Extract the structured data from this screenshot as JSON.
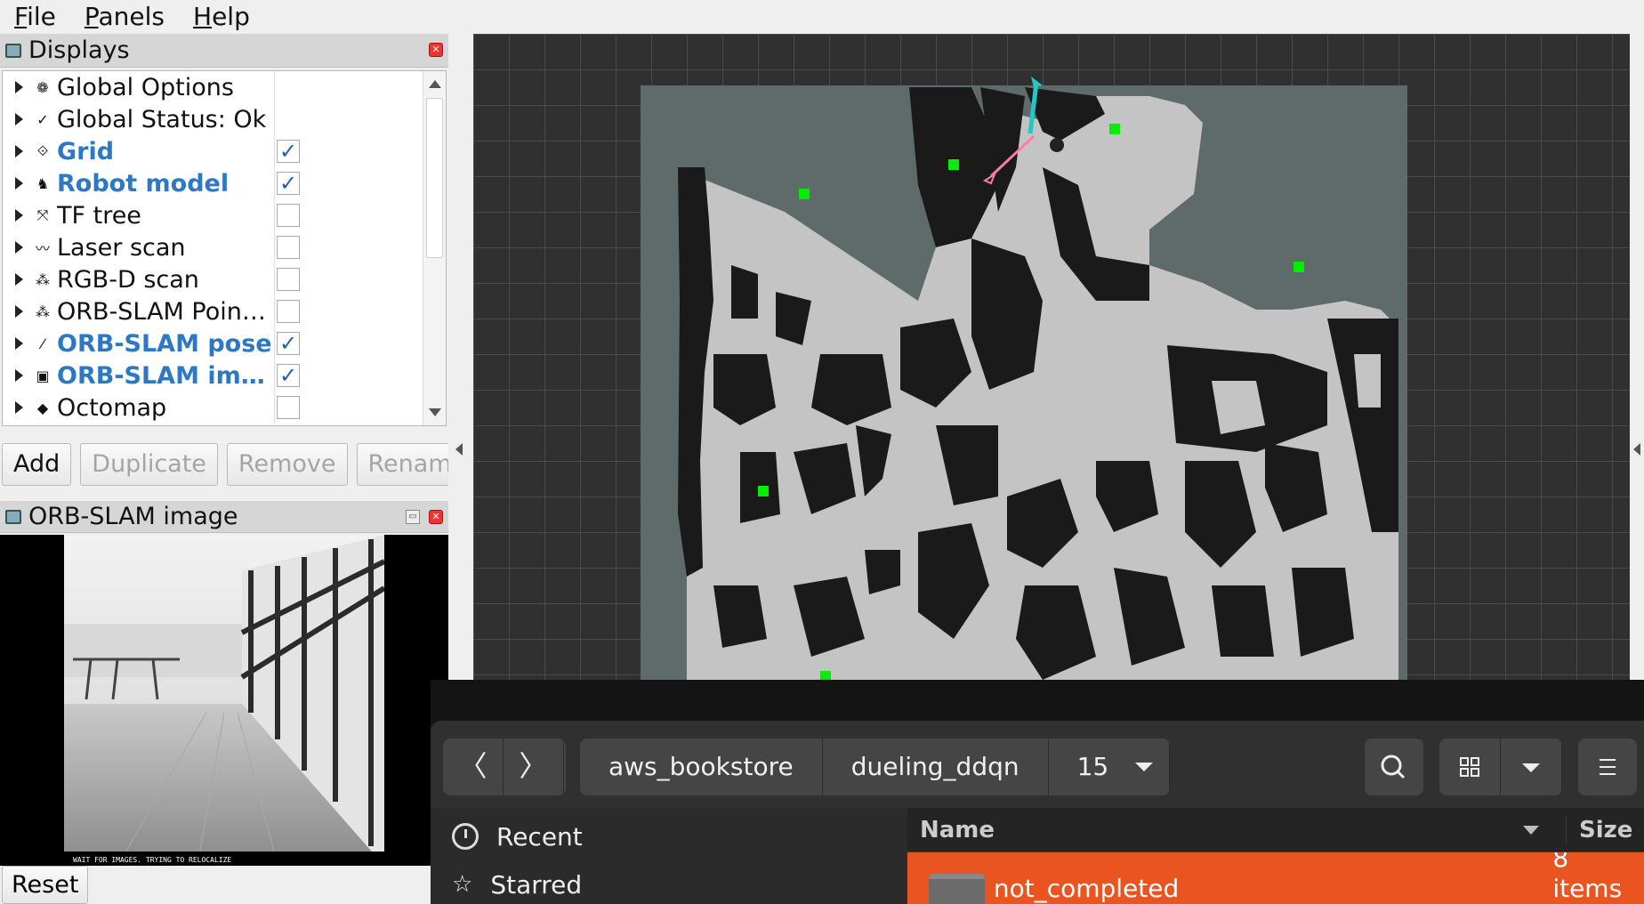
{
  "menubar": {
    "items": [
      {
        "label": "File",
        "accel": "F",
        "rest": "ile"
      },
      {
        "label": "Panels",
        "accel": "P",
        "rest": "anels"
      },
      {
        "label": "Help",
        "accel": "H",
        "rest": "elp"
      }
    ]
  },
  "displays": {
    "title": "Displays",
    "items": [
      {
        "label": "Global Options",
        "icon": "gear-icon",
        "glyph": "❁",
        "checked": null,
        "enabled": false
      },
      {
        "label": "Global Status: Ok",
        "icon": "checkmark-icon",
        "glyph": "✓",
        "checked": null,
        "enabled": false
      },
      {
        "label": "Grid",
        "icon": "grid-icon",
        "glyph": "⟐",
        "checked": true,
        "enabled": true
      },
      {
        "label": "Robot model",
        "icon": "robot-icon",
        "glyph": "♞",
        "checked": true,
        "enabled": true
      },
      {
        "label": "TF tree",
        "icon": "axes-icon",
        "glyph": "⤧",
        "checked": false,
        "enabled": false
      },
      {
        "label": "Laser scan",
        "icon": "laser-icon",
        "glyph": "〰",
        "checked": false,
        "enabled": false
      },
      {
        "label": "RGB-D scan",
        "icon": "pointcloud-icon",
        "glyph": "⁂",
        "checked": false,
        "enabled": false
      },
      {
        "label": "ORB-SLAM Poin…",
        "icon": "pointcloud-icon",
        "glyph": "⁂",
        "checked": false,
        "enabled": false
      },
      {
        "label": "ORB-SLAM pose",
        "icon": "pose-arrow-icon",
        "glyph": "⁄",
        "checked": true,
        "enabled": true
      },
      {
        "label": "ORB-SLAM im…",
        "icon": "image-icon",
        "glyph": "▣",
        "checked": true,
        "enabled": true
      },
      {
        "label": "Octomap",
        "icon": "octomap-icon",
        "glyph": "◆",
        "checked": false,
        "enabled": false
      }
    ],
    "buttons": {
      "add": "Add",
      "duplicate": "Duplicate",
      "remove": "Remove",
      "rename": "Rename"
    }
  },
  "image_panel": {
    "title": "ORB-SLAM image",
    "caption": "WAIT FOR IMAGES. TRYING TO RELOCALIZE",
    "reset": "Reset"
  },
  "file_dialog": {
    "path": [
      "aws_bookstore",
      "dueling_ddqn",
      "15"
    ],
    "sidebar": {
      "recent": "Recent",
      "starred": "Starred"
    },
    "columns": {
      "name": "Name",
      "size": "Size"
    },
    "rows": [
      {
        "name": "not_completed",
        "size": "8 items"
      }
    ],
    "accent": "#e95420"
  },
  "map": {
    "robot_arrow_color": "#22c8c8",
    "path_color": "#ff7aa8",
    "marker_color": "#00ee00"
  }
}
